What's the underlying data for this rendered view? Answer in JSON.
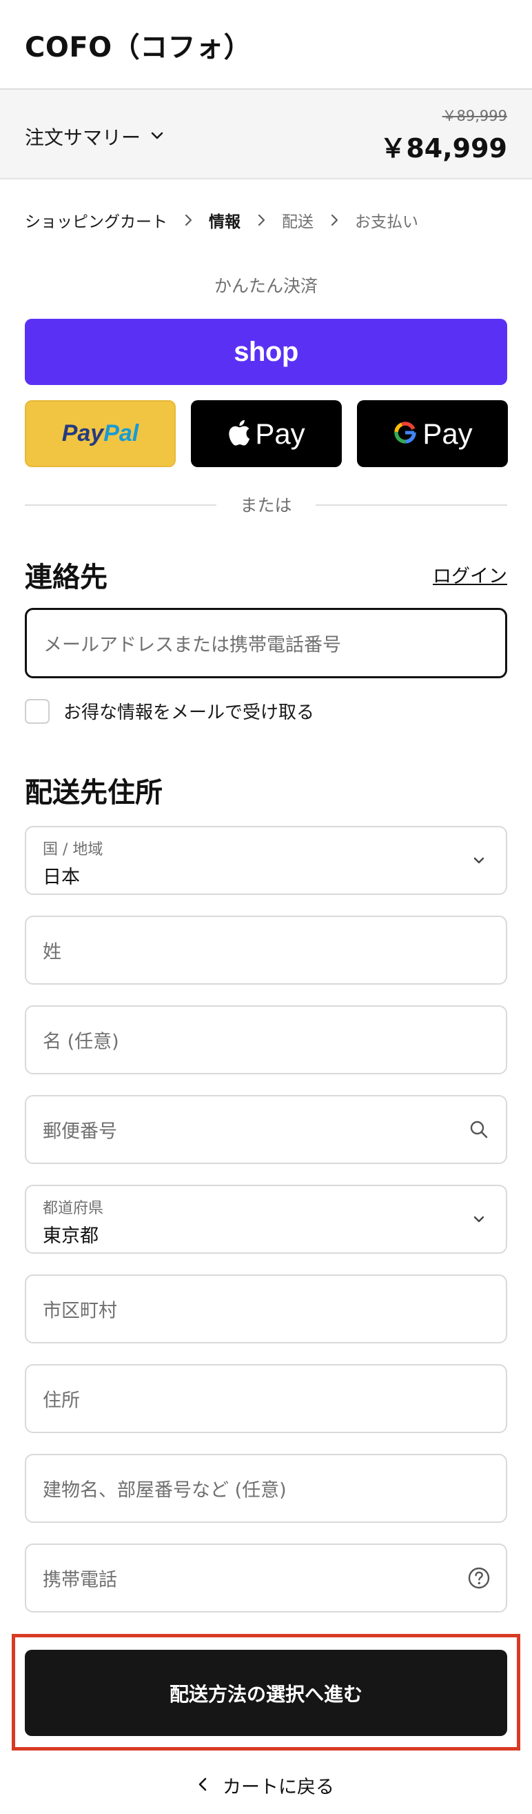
{
  "header": {
    "store_name": "COFO（コフォ）"
  },
  "order_summary": {
    "toggle_label": "注文サマリー",
    "toggle_icon": "chevron-down-icon",
    "original_price": "￥89,999",
    "total_price": "￥84,999"
  },
  "breadcrumb": {
    "items": [
      {
        "label": "ショッピングカート"
      },
      {
        "label": "情報"
      },
      {
        "label": "配送"
      },
      {
        "label": "お支払い"
      }
    ],
    "active_index": 1,
    "separator_icon": "chevron-right-icon"
  },
  "express_checkout": {
    "heading": "かんたん決済",
    "shop_label": "shop",
    "paypal_label_part1": "Pay",
    "paypal_label_part2": "Pal",
    "apple_pay_label": "Pay",
    "google_pay_label": "Pay",
    "divider_text": "または"
  },
  "contact": {
    "title": "連絡先",
    "login_link": "ログイン",
    "email_placeholder": "メールアドレスまたは携帯電話番号",
    "newsletter_label": "お得な情報をメールで受け取る",
    "newsletter_checked": false
  },
  "shipping_address": {
    "title": "配送先住所",
    "country_label": "国 / 地域",
    "country_value": "日本",
    "last_name_placeholder": "姓",
    "first_name_placeholder": "名 (任意)",
    "postal_code_placeholder": "郵便番号",
    "prefecture_label": "都道府県",
    "prefecture_value": "東京都",
    "city_placeholder": "市区町村",
    "address_placeholder": "住所",
    "building_placeholder": "建物名、部屋番号など (任意)",
    "phone_placeholder": "携帯電話"
  },
  "actions": {
    "continue_label": "配送方法の選択へ進む",
    "back_label": "カートに戻る"
  },
  "colors": {
    "shop_pay_purple": "#5a31f4",
    "paypal_yellow": "#f1c542",
    "highlight_red": "#d93a24",
    "primary_button": "#161616"
  }
}
